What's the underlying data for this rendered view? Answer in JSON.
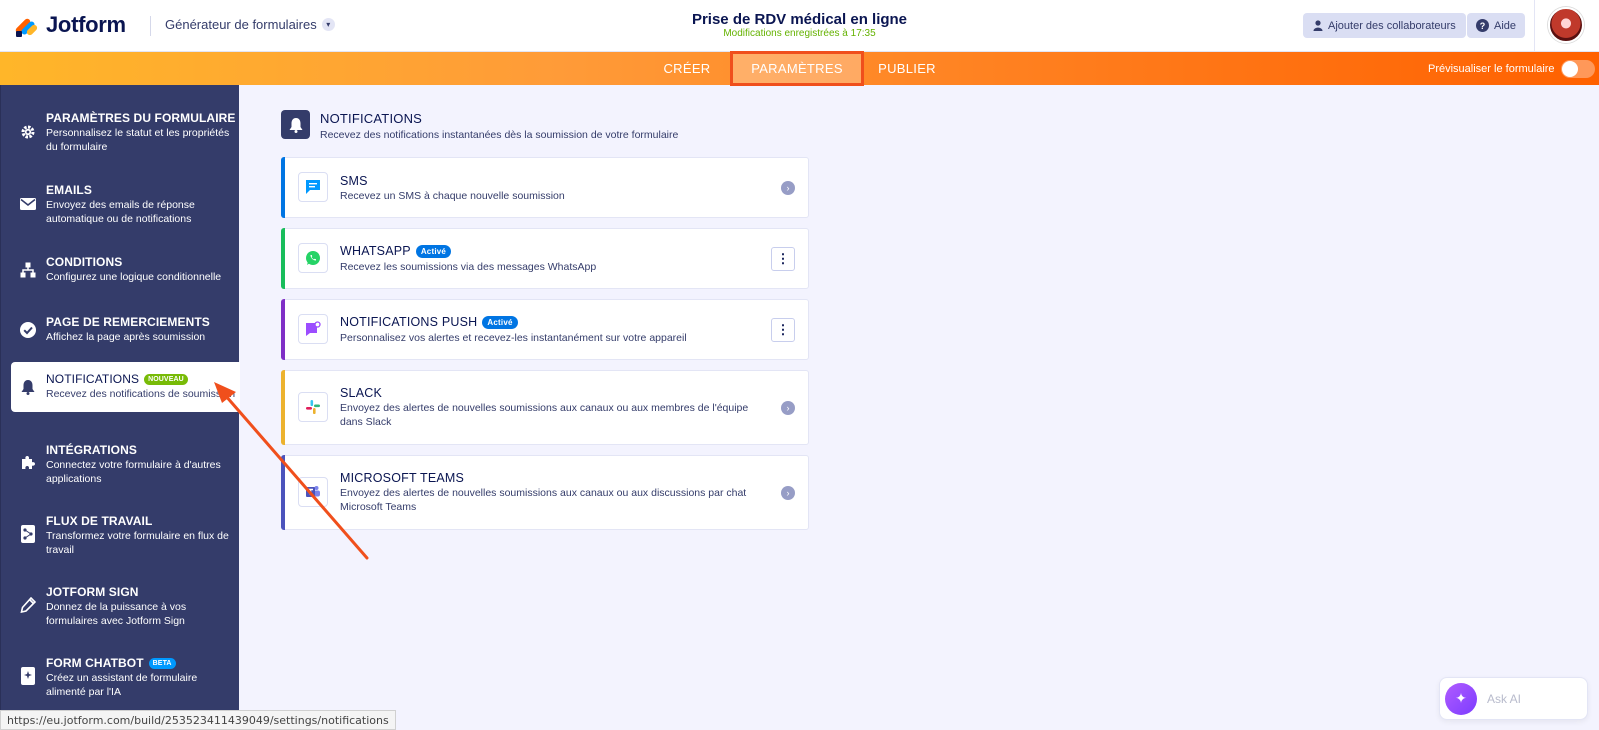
{
  "header": {
    "logo_text": "Jotform",
    "builder_label": "Générateur de formulaires",
    "form_title": "Prise de RDV médical en ligne",
    "saved_status": "Modifications enregistrées à 17:35",
    "collab_label": "Ajouter des collaborateurs",
    "help_label": "Aide"
  },
  "nav": {
    "tabs": [
      "CRÉER",
      "PARAMÈTRES",
      "PUBLIER"
    ],
    "active_tab": "PARAMÈTRES",
    "preview_label": "Prévisualiser le formulaire"
  },
  "sidebar": {
    "items": [
      {
        "title": "PARAMÈTRES DU FORMULAIRE",
        "desc": "Personnalisez le statut et les propriétés du formulaire",
        "icon": "gear-icon"
      },
      {
        "title": "EMAILS",
        "desc": "Envoyez des emails de réponse automatique ou de notifications",
        "icon": "envelope-icon"
      },
      {
        "title": "CONDITIONS",
        "desc": "Configurez une logique conditionnelle",
        "icon": "hierarchy-icon"
      },
      {
        "title": "PAGE DE REMERCIEMENTS",
        "desc": "Affichez la page après soumission",
        "icon": "check-circle-icon"
      },
      {
        "title": "NOTIFICATIONS",
        "badge": "NOUVEAU",
        "desc": "Recevez des notifications de soumission",
        "icon": "bell-icon",
        "active": true
      },
      {
        "title": "INTÉGRATIONS",
        "desc": "Connectez votre formulaire à d'autres applications",
        "icon": "puzzle-icon"
      },
      {
        "title": "FLUX DE TRAVAIL",
        "desc": "Transformez votre formulaire en flux de travail",
        "icon": "workflow-icon"
      },
      {
        "title": "JOTFORM SIGN",
        "desc": "Donnez de la puissance à vos formulaires avec Jotform Sign",
        "icon": "pen-icon"
      },
      {
        "title": "FORM CHATBOT",
        "badge": "BETA",
        "desc": "Créez un assistant de formulaire alimenté par l'IA",
        "icon": "chatbot-icon"
      }
    ]
  },
  "main": {
    "section_title": "NOTIFICATIONS",
    "section_desc": "Recevez des notifications instantanées dès la soumission de votre formulaire",
    "cards": [
      {
        "title": "SMS",
        "desc": "Recevez un SMS à chaque nouvelle soumission",
        "icon": "sms-icon",
        "accent": "#0075e3",
        "action": "chevron"
      },
      {
        "title": "WHATSAPP",
        "badge": "Activé",
        "desc": "Recevez les soumissions via des messages WhatsApp",
        "icon": "whatsapp-icon",
        "accent": "#18bd5b",
        "action": "more"
      },
      {
        "title": "NOTIFICATIONS PUSH",
        "badge": "Activé",
        "desc": "Personnalisez vos alertes et recevez-les instantanément sur votre appareil",
        "icon": "push-icon",
        "accent": "#7f2ec6",
        "action": "more"
      },
      {
        "title": "SLACK",
        "desc": "Envoyez des alertes de nouvelles soumissions aux canaux ou aux membres de l'équipe dans Slack",
        "icon": "slack-icon",
        "accent": "#ecb22e",
        "action": "chevron"
      },
      {
        "title": "MICROSOFT TEAMS",
        "desc": "Envoyez des alertes de nouvelles soumissions aux canaux ou aux discussions par chat Microsoft Teams",
        "icon": "teams-icon",
        "accent": "#4b53bc",
        "action": "chevron"
      }
    ]
  },
  "askai": {
    "label": "Ask AI"
  },
  "status_url": "https://eu.jotform.com/build/253523411439049/settings/notifications",
  "colors": {
    "orange": "#ff6100",
    "sidebar": "#343c6a",
    "annotation": "#f04f1c"
  }
}
